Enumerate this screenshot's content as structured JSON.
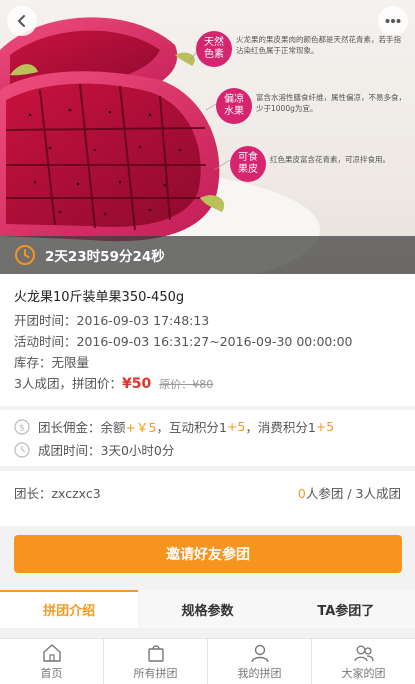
{
  "hero": {
    "badges": [
      {
        "label": "天然色素",
        "desc": "火龙果的果皮果肉的颜色都是天然花青素，若手指沾染红色属于正常现象。"
      },
      {
        "label": "偏凉水果",
        "desc": "富含水溶性膳食纤维，属性偏凉，不易多食，少于1000g为宜。"
      },
      {
        "label": "可食果皮",
        "desc": "红色果皮富含花青素，可凉拌食用。"
      }
    ],
    "countdown": "2天23时59分24秒"
  },
  "product": {
    "title": "火龙果10斤装单果350-450g",
    "open_time": "开团时间：2016-09-03 17:48:13",
    "activity_time": "活动时间：2016-09-03 16:31:27~2016-09-30 00:00:00",
    "stock": "库存：无限量",
    "group_prefix": "3人成团，拼团价：",
    "group_price": "¥50",
    "original_price": "原价：¥80"
  },
  "commission": {
    "prefix": "团长佣金：余额",
    "balance": "+￥5",
    "mid1": "，互动积分1",
    "interact": "+5",
    "mid2": "，消费积分1",
    "consume": "+5",
    "form_time": "成团时间：3天0小时0分"
  },
  "leader": {
    "name": "团长：zxczxc3",
    "joined": "0",
    "joined_suffix": "人参团 / 3人成团"
  },
  "invite_label": "邀请好友参团",
  "tabs": [
    "拼团介绍",
    "规格参数",
    "TA参团了"
  ],
  "nav": [
    {
      "label": "首页",
      "icon": "home-icon"
    },
    {
      "label": "所有拼团",
      "icon": "bag-icon"
    },
    {
      "label": "我的拼团",
      "icon": "user-icon"
    },
    {
      "label": "大家的团",
      "icon": "group-icon"
    }
  ],
  "colors": {
    "accent": "#f7941d",
    "price": "#e4322b",
    "badge": "#d6246e"
  }
}
